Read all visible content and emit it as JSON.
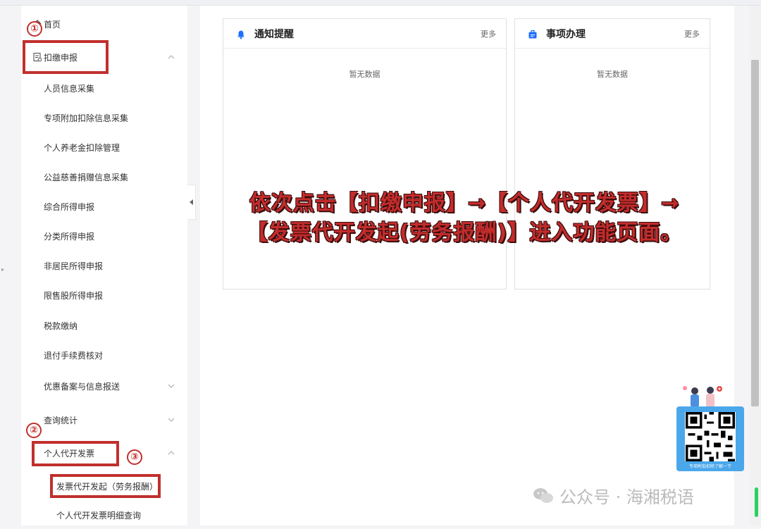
{
  "sidebar": {
    "home": "首页",
    "items": [
      {
        "label": "扣缴申报",
        "has_icon": true,
        "expanded": true
      },
      {
        "label": "人员信息采集"
      },
      {
        "label": "专项附加扣除信息采集"
      },
      {
        "label": "个人养老金扣除管理"
      },
      {
        "label": "公益慈善捐赠信息采集"
      },
      {
        "label": "综合所得申报"
      },
      {
        "label": "分类所得申报"
      },
      {
        "label": "非居民所得申报"
      },
      {
        "label": "限售股所得申报"
      },
      {
        "label": "税款缴纳"
      },
      {
        "label": "退付手续费核对"
      },
      {
        "label": "优惠备案与信息报送",
        "chevron": "down"
      },
      {
        "label": "查询统计",
        "chevron": "down"
      },
      {
        "label": "个人代开发票",
        "chevron": "up"
      },
      {
        "label": "发票代开发起（劳务报酬）"
      },
      {
        "label": "个人代开发票明细查询"
      }
    ]
  },
  "step_markers": [
    "①",
    "②",
    "③"
  ],
  "cards": [
    {
      "title": "通知提醒",
      "more": "更多",
      "empty": "暂无数据",
      "icon": "bell-icon"
    },
    {
      "title": "事项办理",
      "more": "更多",
      "empty": "暂无数据",
      "icon": "briefcase-icon"
    }
  ],
  "overlay": {
    "line1": "依次点击【扣缴申报】→【个人代开发票】→",
    "line2": "【发票代开发起(劳务报酬)】进入功能页面。"
  },
  "qr": {
    "caption": "专项附加扣除了解一下"
  },
  "watermark": "公众号 · 海湘税语",
  "colors": {
    "accent": "#1e6fff",
    "annotation": "#c0302d"
  }
}
